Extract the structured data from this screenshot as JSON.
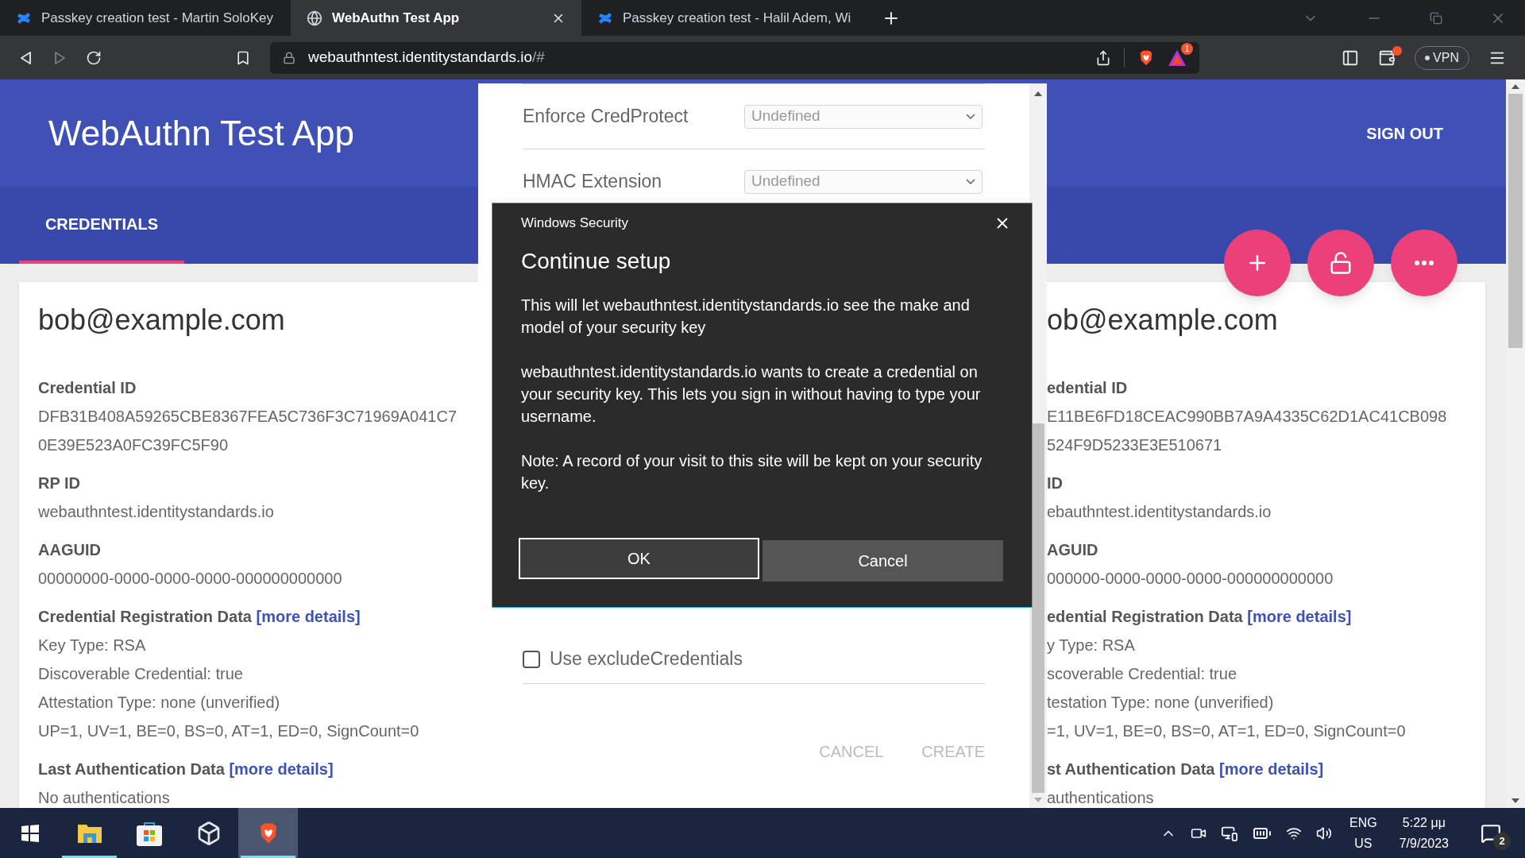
{
  "browser": {
    "tabs": [
      {
        "title": "Passkey creation test - Martin SoloKey",
        "kind": "confluence",
        "selected": false
      },
      {
        "title": "WebAuthn Test App",
        "kind": "globe",
        "selected": true
      },
      {
        "title": "Passkey creation test - Halil Adem, Wi",
        "kind": "confluence",
        "selected": false
      }
    ],
    "address": {
      "host": "webauthntest.identitystandards.io",
      "rest": "/#"
    },
    "alerts_badge": "1",
    "vpn": "VPN"
  },
  "app": {
    "title": "WebAuthn Test App",
    "sign_out": "SIGN OUT",
    "tabs": [
      {
        "label": "CREDENTIALS",
        "selected": true
      }
    ]
  },
  "cards": [
    {
      "email": "bob@example.com",
      "sections": [
        {
          "kind": "field",
          "label": "Credential ID",
          "lines": [
            "DFB31B408A59265CBE8367FEA5C736F3C71969A041C7",
            "0E39E523A0FC39FC5F90"
          ]
        },
        {
          "kind": "field",
          "label": "RP ID",
          "lines": [
            "webauthntest.identitystandards.io"
          ]
        },
        {
          "kind": "field",
          "label": "AAGUID",
          "lines": [
            "00000000-0000-0000-0000-000000000000"
          ]
        },
        {
          "kind": "details",
          "label": "Credential Registration Data",
          "link": "[more details]",
          "lines": [
            "Key Type: RSA",
            "Discoverable Credential: true",
            "Attestation Type: none (unverified)",
            "UP=1, UV=1, BE=0, BS=0, AT=1, ED=0, SignCount=0"
          ]
        },
        {
          "kind": "details",
          "label": "Last Authentication Data",
          "link": "[more details]",
          "lines": [
            "No authentications"
          ]
        }
      ]
    },
    {
      "email": "ob@example.com",
      "sections": [
        {
          "kind": "field",
          "label": "edential ID",
          "lines": [
            "E11BE6FD18CEAC990BB7A9A4335C62D1AC41CB098",
            "524F9D5233E3E510671"
          ]
        },
        {
          "kind": "field",
          "label": "ID",
          "lines": [
            "ebauthntest.identitystandards.io"
          ]
        },
        {
          "kind": "field",
          "label": "AGUID",
          "lines": [
            "000000-0000-0000-0000-000000000000"
          ]
        },
        {
          "kind": "details",
          "label": "edential Registration Data",
          "link": "[more details]",
          "lines": [
            "y Type: RSA",
            "scoverable Credential: true",
            "testation Type: none (unverified)",
            "=1, UV=1, BE=0, BS=0, AT=1, ED=0, SignCount=0"
          ]
        },
        {
          "kind": "details",
          "label": "st Authentication Data",
          "link": "[more details]",
          "lines": [
            "authentications"
          ]
        }
      ]
    }
  ],
  "fabs": [
    {
      "kind": "add"
    },
    {
      "kind": "lock"
    },
    {
      "kind": "more"
    }
  ],
  "create_form": {
    "rows": [
      {
        "label": "Enforce CredProtect",
        "value": "Undefined"
      },
      {
        "label": "HMAC Extension",
        "value": "Undefined"
      }
    ],
    "checkbox": {
      "label": "Use excludeCredentials",
      "checked": false
    },
    "actions": [
      {
        "label": "CANCEL",
        "disabled": true
      },
      {
        "label": "CREATE",
        "disabled": true
      }
    ]
  },
  "security_dialog": {
    "caption": "Windows Security",
    "title": "Continue setup",
    "paragraphs": [
      "This will let webauthntest.identitystandards.io see the make and model of your security key",
      "webauthntest.identitystandards.io wants to create a credential on your security key. This lets you sign in without having to type your username.",
      "Note: A record of your visit to this site will be kept on your security key."
    ],
    "buttons": [
      {
        "label": "OK",
        "focused": true
      },
      {
        "label": "Cancel",
        "focused": false
      }
    ]
  },
  "taskbar": {
    "apps": [
      {
        "kind": "start",
        "running": false,
        "active": false
      },
      {
        "kind": "explorer",
        "running": true,
        "active": false
      },
      {
        "kind": "store",
        "running": false,
        "active": false
      },
      {
        "kind": "cube",
        "running": false,
        "active": false
      },
      {
        "kind": "brave",
        "running": true,
        "active": true
      }
    ],
    "language": [
      "ENG",
      "US"
    ],
    "time": "5:22 μμ",
    "date": "7/9/2023",
    "notifications": "2"
  }
}
